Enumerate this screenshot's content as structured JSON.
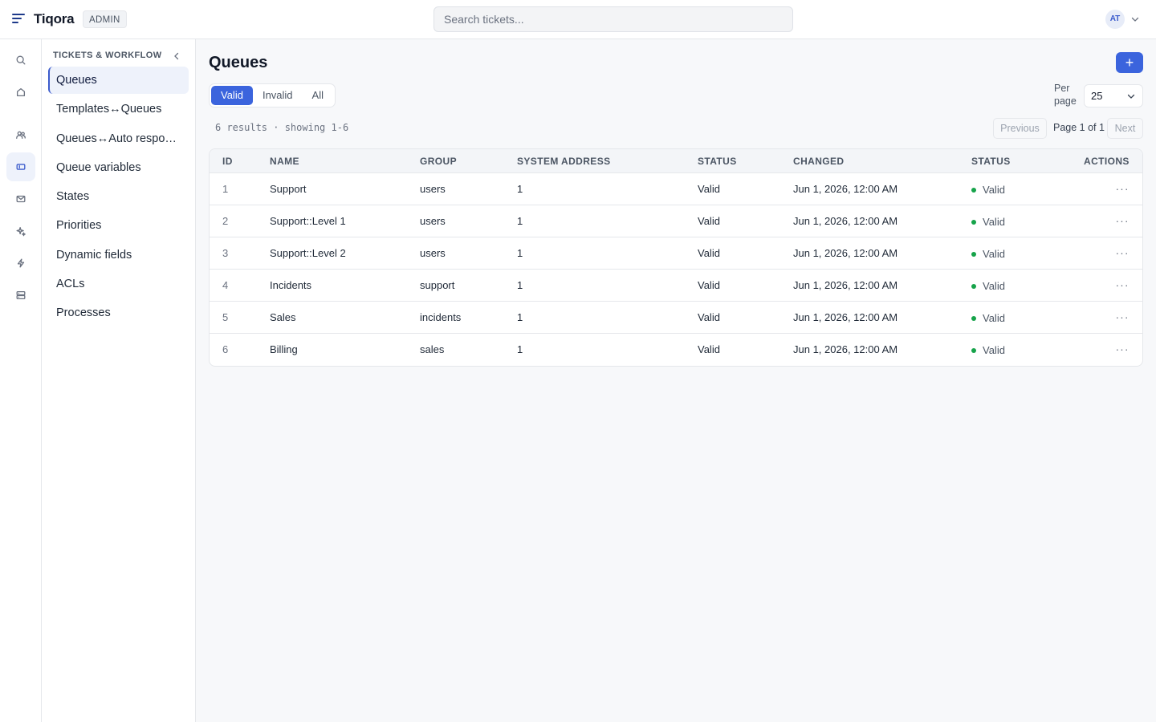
{
  "app": {
    "brand": "Tiqora",
    "badge": "ADMIN"
  },
  "search": {
    "placeholder": "Search tickets..."
  },
  "user": {
    "initials": "AT"
  },
  "rail": [
    "search-icon",
    "home-icon",
    "users-icon",
    "ticket-icon",
    "mail-icon",
    "sparkle-icon",
    "bolt-icon",
    "server-icon"
  ],
  "sidebar": {
    "title": "TICKETS & WORKFLOW",
    "items": [
      {
        "label": "Queues"
      },
      {
        "label": "Templates↔Queues"
      },
      {
        "label": "Queues↔Auto responses"
      },
      {
        "label": "Queue variables"
      },
      {
        "label": "States"
      },
      {
        "label": "Priorities"
      },
      {
        "label": "Dynamic fields"
      },
      {
        "label": "ACLs"
      },
      {
        "label": "Processes"
      }
    ]
  },
  "main": {
    "title": "Queues",
    "add_label": "+",
    "filters": [
      "Valid",
      "Invalid",
      "All"
    ],
    "active_filter": "Valid",
    "per_page_label": "Per page",
    "per_page_value": "25",
    "results_text": "6 results · showing 1-6",
    "pager": {
      "prev": "Previous",
      "info": "Page 1 of 1",
      "next": "Next"
    },
    "table": {
      "columns": [
        "ID",
        "NAME",
        "GROUP",
        "SYSTEM ADDRESS",
        "STATUS",
        "CHANGED",
        "STATUS",
        "ACTIONS"
      ],
      "rows": [
        {
          "id": "1",
          "name": "Support",
          "group": "users",
          "address": "1",
          "status": "Valid",
          "changed": "Jun 1, 2026, 12:00 AM",
          "state": "Valid"
        },
        {
          "id": "2",
          "name": "Support::Level 1",
          "group": "users",
          "address": "1",
          "status": "Valid",
          "changed": "Jun 1, 2026, 12:00 AM",
          "state": "Valid"
        },
        {
          "id": "3",
          "name": "Support::Level 2",
          "group": "users",
          "address": "1",
          "status": "Valid",
          "changed": "Jun 1, 2026, 12:00 AM",
          "state": "Valid"
        },
        {
          "id": "4",
          "name": "Incidents",
          "group": "support",
          "address": "1",
          "status": "Valid",
          "changed": "Jun 1, 2026, 12:00 AM",
          "state": "Valid"
        },
        {
          "id": "5",
          "name": "Sales",
          "group": "incidents",
          "address": "1",
          "status": "Valid",
          "changed": "Jun 1, 2026, 12:00 AM",
          "state": "Valid"
        },
        {
          "id": "6",
          "name": "Billing",
          "group": "sales",
          "address": "1",
          "status": "Valid",
          "changed": "Jun 1, 2026, 12:00 AM",
          "state": "Valid"
        }
      ]
    }
  },
  "colors": {
    "accent": "#3b64dd",
    "valid_dot": "#16a34a",
    "brand_dark": "#1e3a8a"
  }
}
